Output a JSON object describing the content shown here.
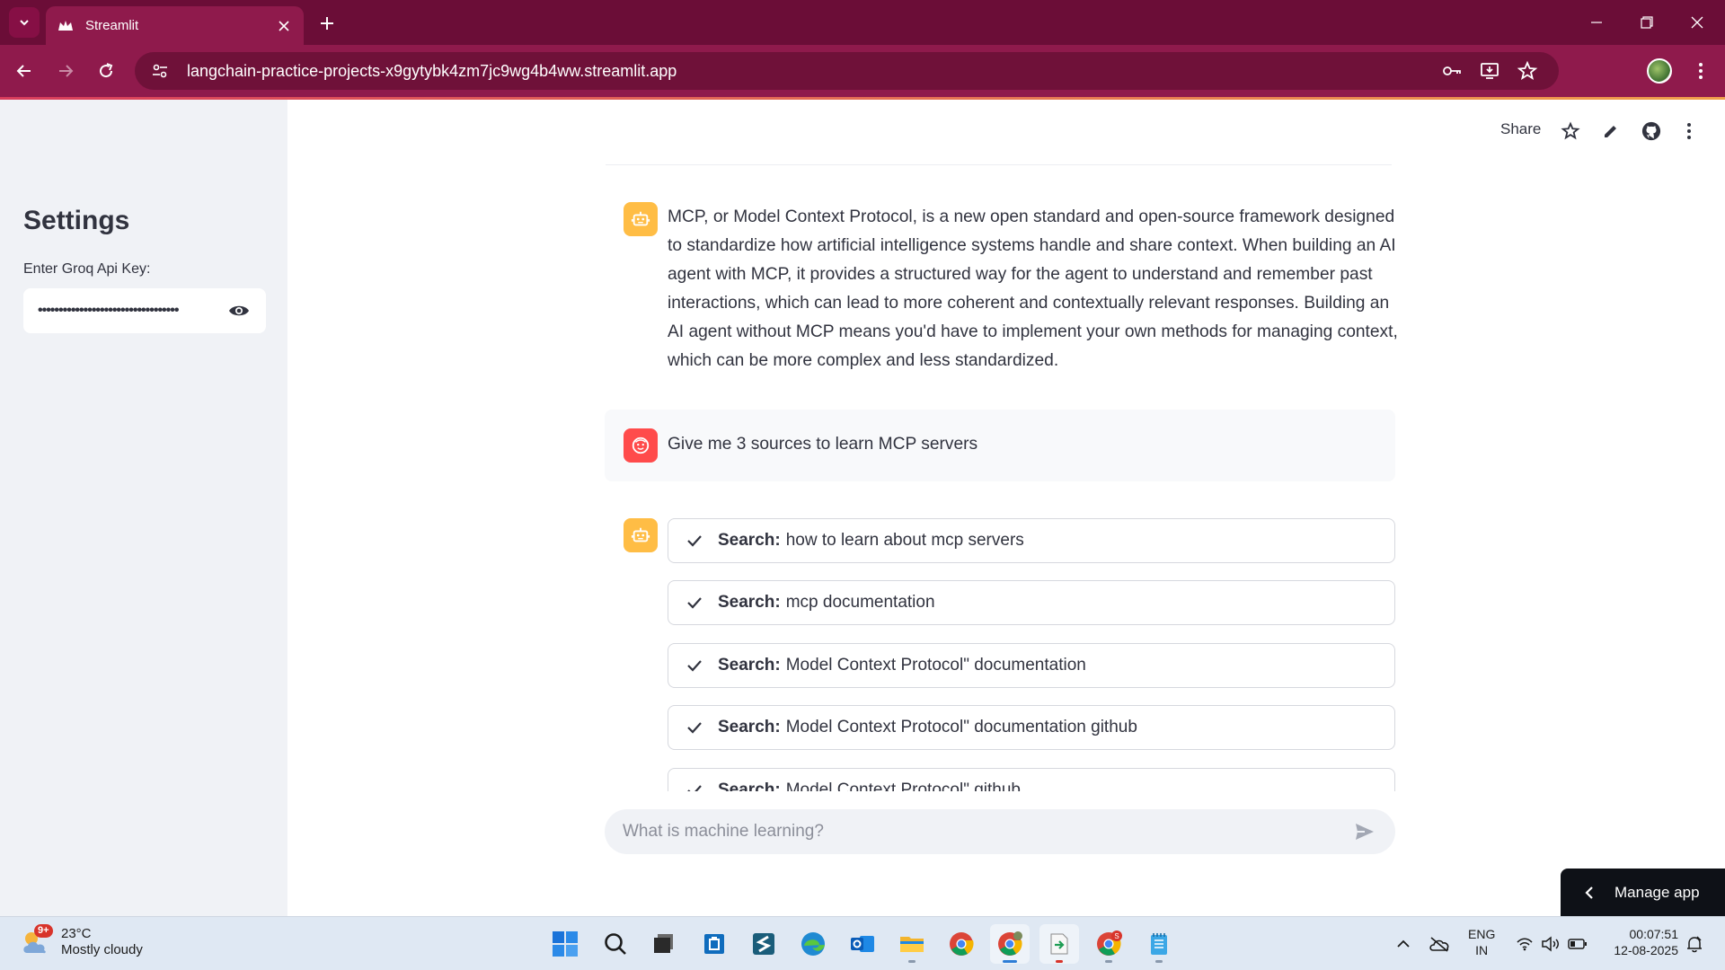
{
  "browser": {
    "tab_title": "Streamlit",
    "url": "langchain-practice-projects-x9gytybk4zm7jc9wg4b4ww.streamlit.app"
  },
  "sidebar": {
    "title": "Settings",
    "api_key_label": "Enter Groq Api Key:",
    "api_key_value": "••••••••••••••••••••••••••••••••••"
  },
  "header": {
    "share_label": "Share"
  },
  "chat": {
    "assistant_message": "MCP, or Model Context Protocol, is a new open standard and open-source framework designed to standardize how artificial intelligence systems handle and share context. When building an AI agent with MCP, it provides a structured way for the agent to understand and remember past interactions, which can lead to more coherent and contextually relevant responses. Building an AI agent without MCP means you'd have to implement your own methods for managing context, which can be more complex and less standardized.",
    "user_message": "Give me 3 sources to learn MCP servers",
    "steps": [
      {
        "prefix": "Search:",
        "query": "how to learn about mcp servers"
      },
      {
        "prefix": "Search:",
        "query": "mcp documentation"
      },
      {
        "prefix": "Search:",
        "query": "Model Context Protocol\" documentation"
      },
      {
        "prefix": "Search:",
        "query": "Model Context Protocol\" documentation github"
      },
      {
        "prefix": "Search:",
        "query": "Model Context Protocol\" github"
      }
    ],
    "input_placeholder": "What is machine learning?"
  },
  "manage_app_label": "Manage app",
  "taskbar": {
    "weather_badge": "9+",
    "temperature": "23°C",
    "condition": "Mostly cloudy",
    "lang_line1": "ENG",
    "lang_line2": "IN",
    "time": "00:07:51",
    "date": "12-08-2025",
    "notification_badge": "S"
  },
  "colors": {
    "browser_frame": "#6b0d37",
    "browser_toolbar": "#8f1a4c",
    "assistant_avatar": "#ffbd45",
    "user_avatar": "#ff4b4b",
    "sidebar_bg": "#f0f2f6"
  }
}
